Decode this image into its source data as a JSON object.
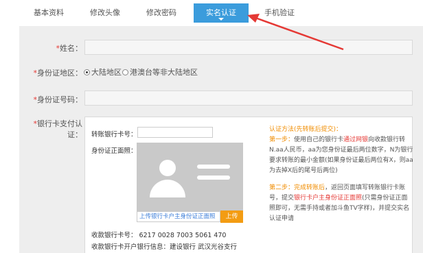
{
  "tabs": [
    {
      "label": "基本资料",
      "active": false
    },
    {
      "label": "修改头像",
      "active": false
    },
    {
      "label": "修改密码",
      "active": false
    },
    {
      "label": "实名认证",
      "active": true
    },
    {
      "label": "手机验证",
      "active": false
    }
  ],
  "form": {
    "name_label": "姓名：",
    "region_label": "身份证地区：",
    "region_options": [
      "大陆地区",
      "港澳台等非大陆地区"
    ],
    "region_selected": "大陆地区",
    "idnum_label": "身份证号码：",
    "bank_label": "银行卡支付认证："
  },
  "bank": {
    "card_label": "转账银行卡号：",
    "id_photo_label": "身份证正面照：",
    "upload_hint": "上传银行卡户主身份证正面照",
    "upload_button": "上传",
    "receive_card": "收款银行卡号：  6217 0028 7003 5061 470",
    "receive_bank": "收款银行卡开户银行信息：建设银行 武汉光谷支行"
  },
  "help": {
    "title": "认证方法(先转账后提交)：",
    "step1_prefix": "第一步：",
    "step1_a": "使用自己的银行卡",
    "step1_b": "通过网银",
    "step1_c": "向收款银行转N.aa人民币，aa为您身份证最后两位数字，N为银行要求转账的最小金额(如果身份证最后两位有X，则aa为去掉X后的尾号后两位)",
    "step2_prefix": "第二步：",
    "step2_a": "完成转账后",
    "step2_b": "，返回页面填写转账银行卡账号，提交",
    "step2_c": "银行卡户主身份证正面照",
    "step2_d": "(只需身份证正面照即可，无需手持或者加斗鱼TV字样)，并提交实名认证申请"
  },
  "colors": {
    "accent": "#3b9cdc",
    "orange": "#f08c00",
    "red": "#e53935"
  }
}
